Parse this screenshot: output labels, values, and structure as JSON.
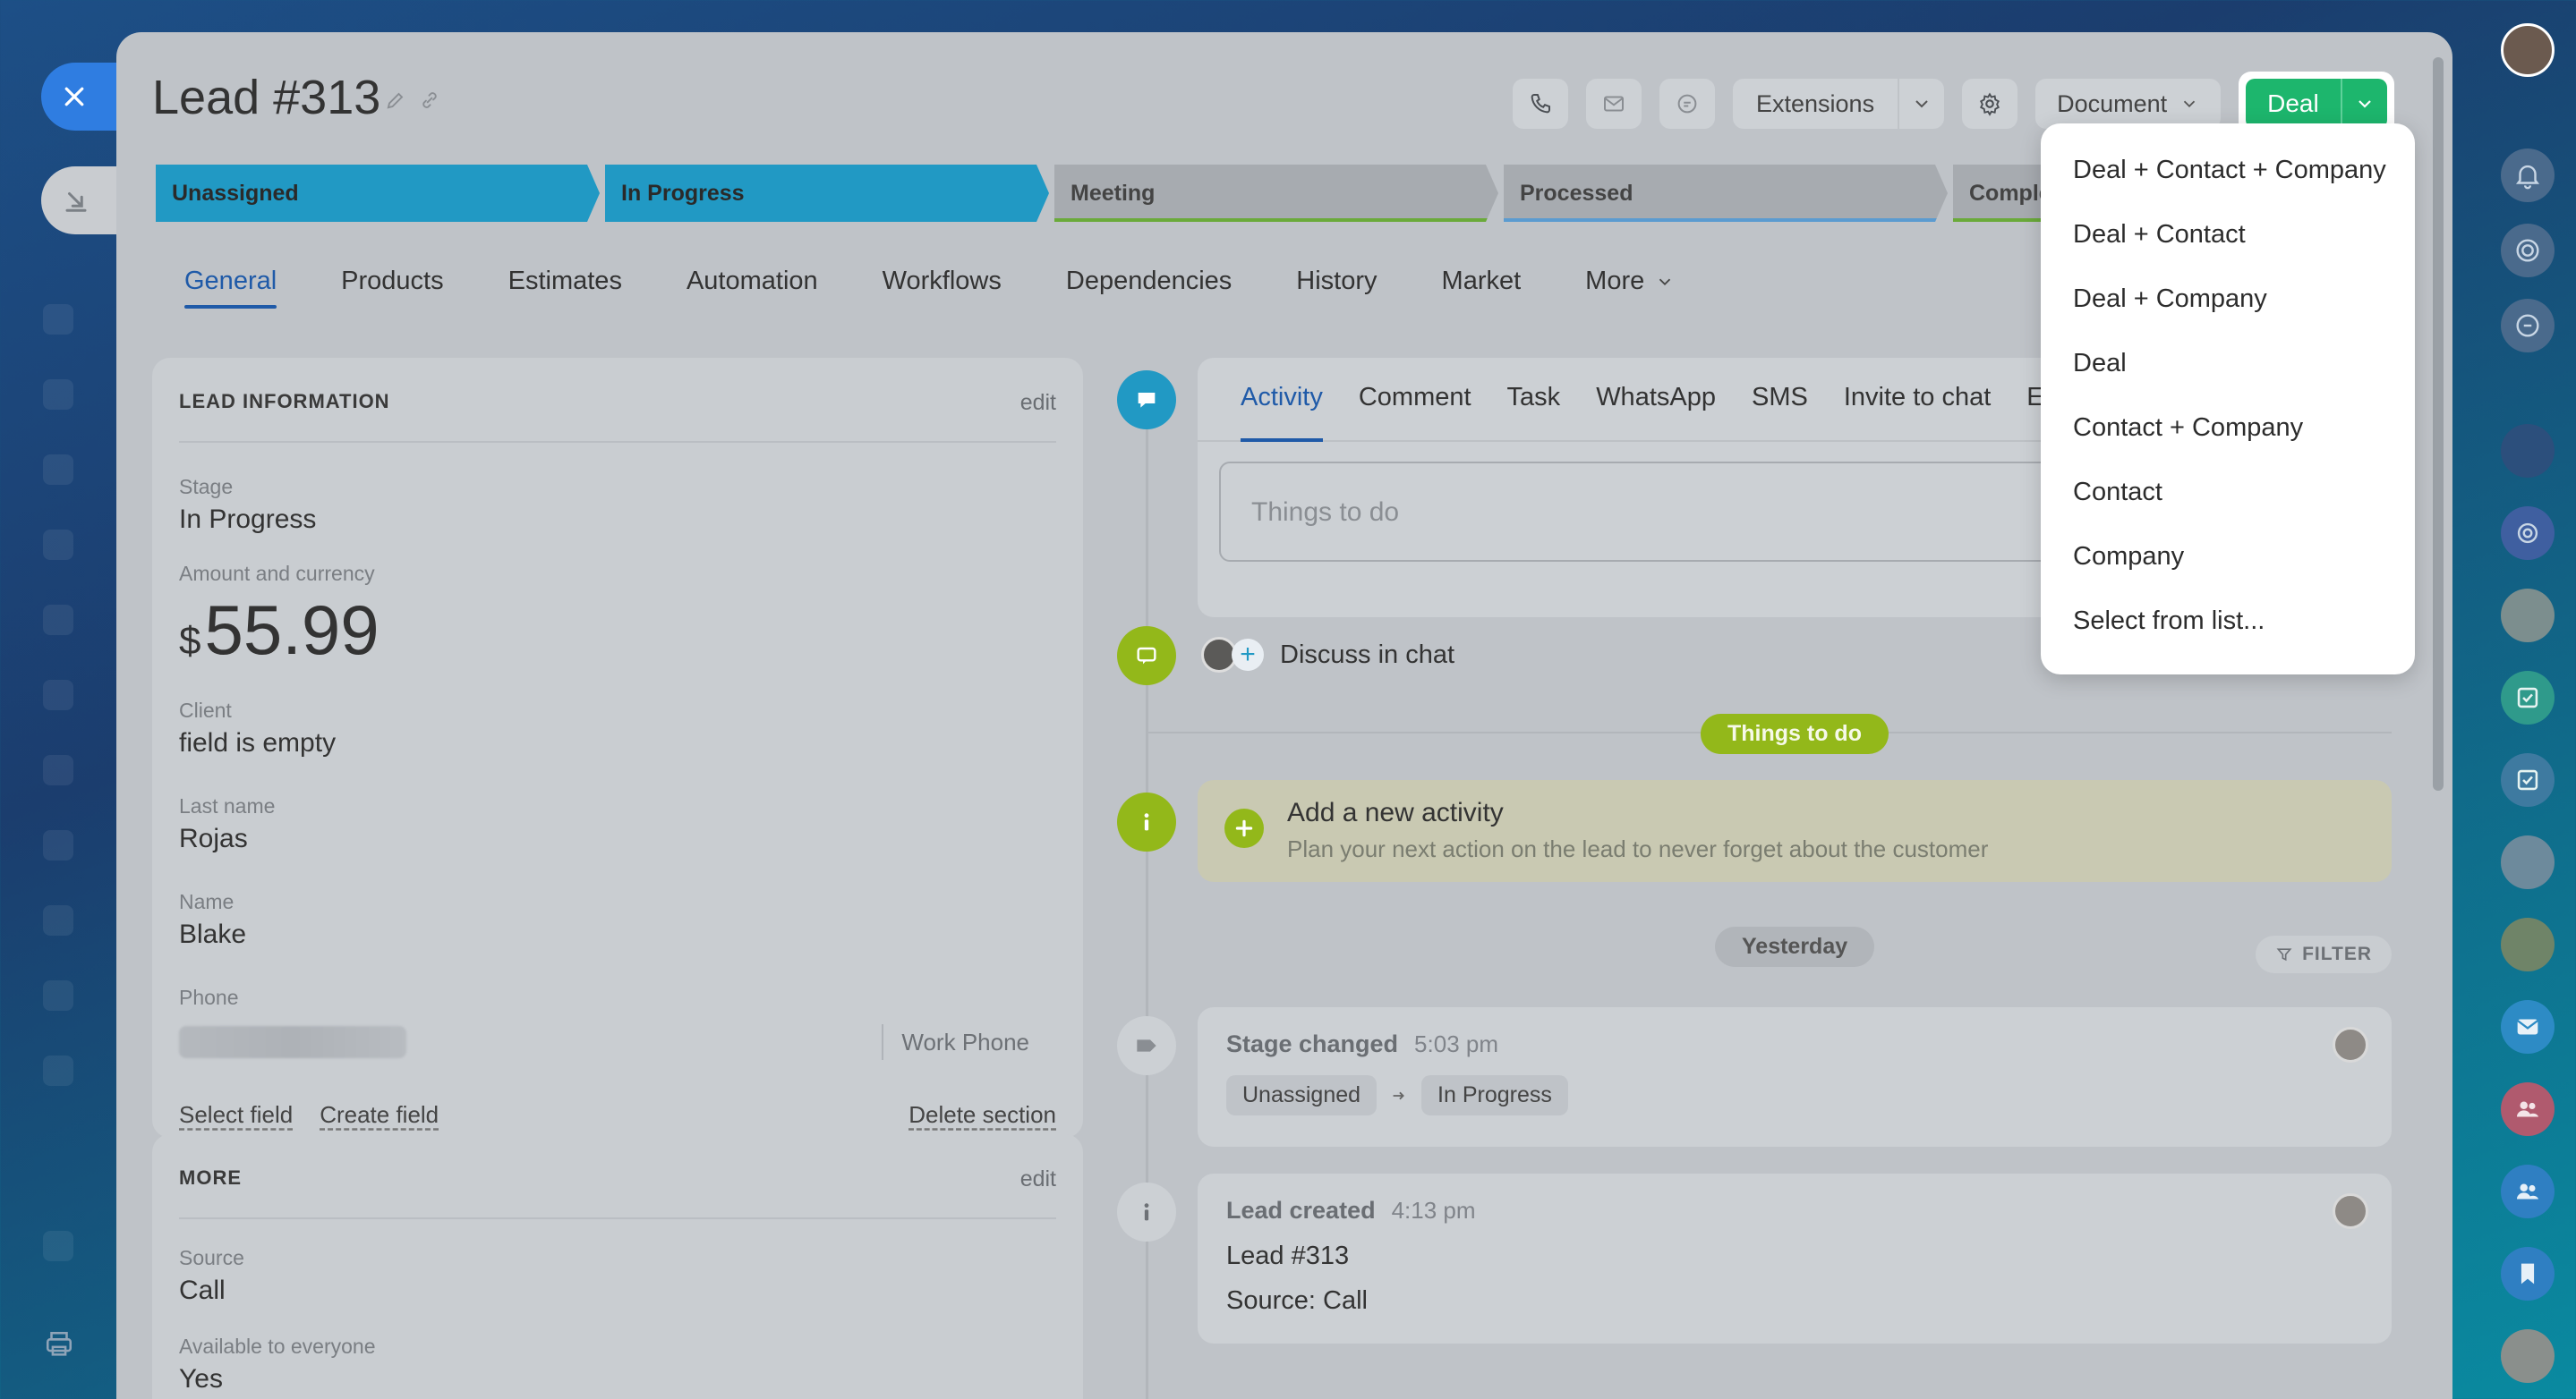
{
  "lead": {
    "title": "Lead #313"
  },
  "toolbar": {
    "extensions_label": "Extensions",
    "document_label": "Document",
    "deal_label": "Deal"
  },
  "stages": [
    {
      "label": "Unassigned",
      "state": "active"
    },
    {
      "label": "In Progress",
      "state": "active"
    },
    {
      "label": "Meeting",
      "state": "inactive"
    },
    {
      "label": "Processed",
      "state": "inactive"
    },
    {
      "label": "Comple",
      "state": "inactive"
    }
  ],
  "tabs": {
    "general": "General",
    "products": "Products",
    "estimates": "Estimates",
    "automation": "Automation",
    "workflows": "Workflows",
    "dependencies": "Dependencies",
    "history": "History",
    "market": "Market",
    "more": "More"
  },
  "lead_info": {
    "heading": "LEAD INFORMATION",
    "edit": "edit",
    "stage_label": "Stage",
    "stage_value": "In Progress",
    "amount_label": "Amount and currency",
    "currency_symbol": "$",
    "amount_value": "55.99",
    "client_label": "Client",
    "client_value": "field is empty",
    "last_name_label": "Last name",
    "last_name_value": "Rojas",
    "name_label": "Name",
    "name_value": "Blake",
    "phone_label": "Phone",
    "phone_type": "Work Phone",
    "select_field": "Select field",
    "create_field": "Create field",
    "delete_section": "Delete section"
  },
  "more_section": {
    "heading": "MORE",
    "edit": "edit",
    "source_label": "Source",
    "source_value": "Call",
    "available_label": "Available to everyone",
    "available_value": "Yes"
  },
  "activity": {
    "tabs": {
      "activity": "Activity",
      "comment": "Comment",
      "task": "Task",
      "whatsapp": "WhatsApp",
      "sms": "SMS",
      "invite": "Invite to chat",
      "overflow": "E"
    },
    "input_placeholder": "Things to do",
    "discuss": "Discuss in chat",
    "things_to_do_pill": "Things to do",
    "add_title": "Add a new activity",
    "add_subtitle": "Plan your next action on the lead to never forget about the customer",
    "yesterday_pill": "Yesterday",
    "filter_label": "FILTER",
    "stage_changed_title": "Stage changed",
    "stage_changed_time": "5:03 pm",
    "stage_from": "Unassigned",
    "stage_to": "In Progress",
    "lead_created_title": "Lead created",
    "lead_created_time": "4:13 pm",
    "lead_created_line1": "Lead #313",
    "lead_created_line2": "Source: Call"
  },
  "dropdown": {
    "items": [
      "Deal + Contact + Company",
      "Deal + Contact",
      "Deal + Company",
      "Deal",
      "Contact + Company",
      "Contact",
      "Company",
      "Select from list..."
    ]
  },
  "colors": {
    "accent_blue": "#2199c4",
    "deal_green": "#1db66d",
    "tab_active": "#1f5aa8",
    "pill_green": "#93b81a"
  }
}
